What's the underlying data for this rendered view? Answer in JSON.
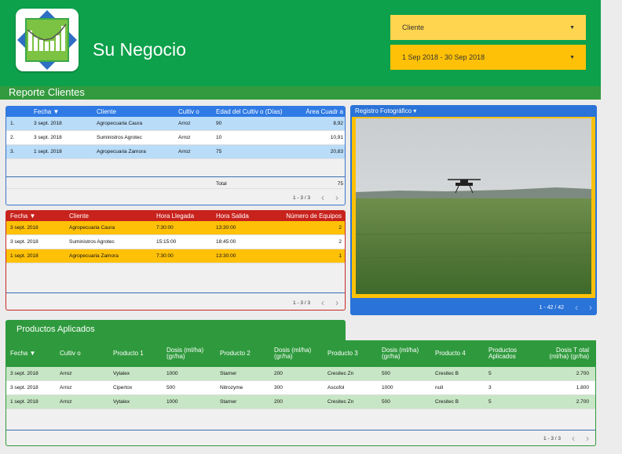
{
  "colors": {
    "header_green": "#0ca14a",
    "section_green": "#339a3f",
    "blue_accent": "#2f7ae5",
    "red_accent": "#c8221c",
    "yellow_accent": "#ffc107",
    "light_yellow": "#ffd54f"
  },
  "logo": {
    "icon": "bar-chart-logo-icon"
  },
  "header": {
    "brand": "Su Negocio",
    "client_filter": "Cliente",
    "date_filter": "1 Sep 2018 - 30 Sep 2018"
  },
  "report_title": "Reporte Clientes",
  "cultivos": {
    "headers": [
      "Fecha ▼",
      "Cliente",
      "Cultiv o",
      "Edad del Cultiv o (Días)",
      "Área Cuadr a"
    ],
    "rows": [
      [
        "1.",
        "3 sept. 2018",
        "Agropecuaria Caura",
        "Arroz",
        "90",
        "8,92"
      ],
      [
        "2.",
        "3 sept. 2018",
        "Suministros Agrotec",
        "Arroz",
        "10",
        "10,91"
      ],
      [
        "3.",
        "1 sept. 2018",
        "Agropecuaria Zamora",
        "Arroz",
        "75",
        "20,83"
      ]
    ],
    "total_label": "Total",
    "total_value": "75",
    "pagination": "1 - 3 / 3"
  },
  "visitas": {
    "headers": [
      "Fecha ▼",
      "Cliente",
      "Hora Llegada",
      "Hora Salida",
      "Número de Equipos"
    ],
    "rows": [
      [
        "3 sept. 2018",
        "Agropecuaria Caura",
        "7:30:00",
        "13:30:00",
        "2"
      ],
      [
        "3 sept. 2018",
        "Suministros Agrotec",
        "15:15:00",
        "18:45:00",
        "2"
      ],
      [
        "1 sept. 2018",
        "Agropecuaria Zamora",
        "7:30:00",
        "13:30:00",
        "1"
      ]
    ],
    "pagination": "1 - 3 / 3"
  },
  "photo": {
    "header": "Registro  Fotográfico ▾",
    "pagination": "1 - 42 / 42"
  },
  "productos": {
    "title": "Productos Aplicados",
    "headers": [
      "Fecha ▼",
      "Cultiv o",
      "Producto 1",
      "Dosis (ml/ha) (gr/ha)",
      "Producto 2",
      "Dosis (ml/ha) (gr/ha)",
      "Producto 3",
      "Dosis (ml/ha) (gr/ha)",
      "Producto 4",
      "Productos Aplicados",
      "Dosis T otal (ml/ha) (gr/ha)"
    ],
    "rows": [
      [
        "3 sept. 2018",
        "Arroz",
        "Vytalex",
        "1000",
        "Starner",
        "200",
        "Cresitec Zn",
        "500",
        "Cresitec B",
        "5",
        "2.700"
      ],
      [
        "3 sept. 2018",
        "Arroz",
        "Cipertox",
        "500",
        "Nitrozyme",
        "300",
        "Ascofol",
        "1000",
        "null",
        "3",
        "1.800"
      ],
      [
        "1 sept. 2018",
        "Arroz",
        "Vytalex",
        "1000",
        "Starner",
        "200",
        "Cresitec Zn",
        "500",
        "Cresitec B",
        "5",
        "2.700"
      ]
    ],
    "pagination": "1 - 3 / 3"
  },
  "nav": {
    "prev": "‹",
    "next": "›"
  }
}
